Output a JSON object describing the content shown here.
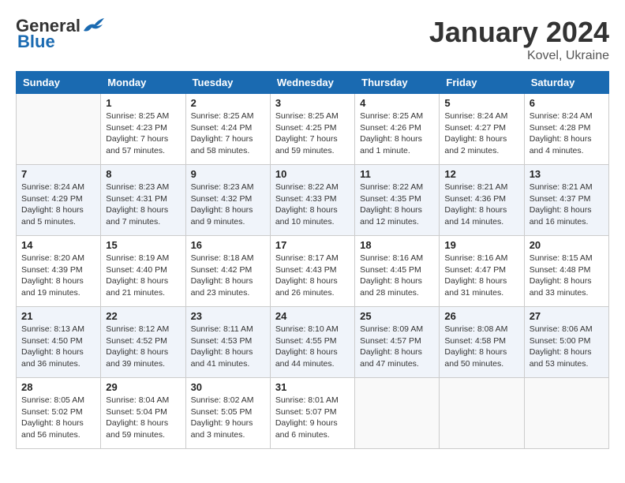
{
  "logo": {
    "general": "General",
    "blue": "Blue"
  },
  "title": "January 2024",
  "location": "Kovel, Ukraine",
  "days_header": [
    "Sunday",
    "Monday",
    "Tuesday",
    "Wednesday",
    "Thursday",
    "Friday",
    "Saturday"
  ],
  "weeks": [
    [
      {
        "day": "",
        "info": ""
      },
      {
        "day": "1",
        "info": "Sunrise: 8:25 AM\nSunset: 4:23 PM\nDaylight: 7 hours\nand 57 minutes."
      },
      {
        "day": "2",
        "info": "Sunrise: 8:25 AM\nSunset: 4:24 PM\nDaylight: 7 hours\nand 58 minutes."
      },
      {
        "day": "3",
        "info": "Sunrise: 8:25 AM\nSunset: 4:25 PM\nDaylight: 7 hours\nand 59 minutes."
      },
      {
        "day": "4",
        "info": "Sunrise: 8:25 AM\nSunset: 4:26 PM\nDaylight: 8 hours\nand 1 minute."
      },
      {
        "day": "5",
        "info": "Sunrise: 8:24 AM\nSunset: 4:27 PM\nDaylight: 8 hours\nand 2 minutes."
      },
      {
        "day": "6",
        "info": "Sunrise: 8:24 AM\nSunset: 4:28 PM\nDaylight: 8 hours\nand 4 minutes."
      }
    ],
    [
      {
        "day": "7",
        "info": "Sunrise: 8:24 AM\nSunset: 4:29 PM\nDaylight: 8 hours\nand 5 minutes."
      },
      {
        "day": "8",
        "info": "Sunrise: 8:23 AM\nSunset: 4:31 PM\nDaylight: 8 hours\nand 7 minutes."
      },
      {
        "day": "9",
        "info": "Sunrise: 8:23 AM\nSunset: 4:32 PM\nDaylight: 8 hours\nand 9 minutes."
      },
      {
        "day": "10",
        "info": "Sunrise: 8:22 AM\nSunset: 4:33 PM\nDaylight: 8 hours\nand 10 minutes."
      },
      {
        "day": "11",
        "info": "Sunrise: 8:22 AM\nSunset: 4:35 PM\nDaylight: 8 hours\nand 12 minutes."
      },
      {
        "day": "12",
        "info": "Sunrise: 8:21 AM\nSunset: 4:36 PM\nDaylight: 8 hours\nand 14 minutes."
      },
      {
        "day": "13",
        "info": "Sunrise: 8:21 AM\nSunset: 4:37 PM\nDaylight: 8 hours\nand 16 minutes."
      }
    ],
    [
      {
        "day": "14",
        "info": "Sunrise: 8:20 AM\nSunset: 4:39 PM\nDaylight: 8 hours\nand 19 minutes."
      },
      {
        "day": "15",
        "info": "Sunrise: 8:19 AM\nSunset: 4:40 PM\nDaylight: 8 hours\nand 21 minutes."
      },
      {
        "day": "16",
        "info": "Sunrise: 8:18 AM\nSunset: 4:42 PM\nDaylight: 8 hours\nand 23 minutes."
      },
      {
        "day": "17",
        "info": "Sunrise: 8:17 AM\nSunset: 4:43 PM\nDaylight: 8 hours\nand 26 minutes."
      },
      {
        "day": "18",
        "info": "Sunrise: 8:16 AM\nSunset: 4:45 PM\nDaylight: 8 hours\nand 28 minutes."
      },
      {
        "day": "19",
        "info": "Sunrise: 8:16 AM\nSunset: 4:47 PM\nDaylight: 8 hours\nand 31 minutes."
      },
      {
        "day": "20",
        "info": "Sunrise: 8:15 AM\nSunset: 4:48 PM\nDaylight: 8 hours\nand 33 minutes."
      }
    ],
    [
      {
        "day": "21",
        "info": "Sunrise: 8:13 AM\nSunset: 4:50 PM\nDaylight: 8 hours\nand 36 minutes."
      },
      {
        "day": "22",
        "info": "Sunrise: 8:12 AM\nSunset: 4:52 PM\nDaylight: 8 hours\nand 39 minutes."
      },
      {
        "day": "23",
        "info": "Sunrise: 8:11 AM\nSunset: 4:53 PM\nDaylight: 8 hours\nand 41 minutes."
      },
      {
        "day": "24",
        "info": "Sunrise: 8:10 AM\nSunset: 4:55 PM\nDaylight: 8 hours\nand 44 minutes."
      },
      {
        "day": "25",
        "info": "Sunrise: 8:09 AM\nSunset: 4:57 PM\nDaylight: 8 hours\nand 47 minutes."
      },
      {
        "day": "26",
        "info": "Sunrise: 8:08 AM\nSunset: 4:58 PM\nDaylight: 8 hours\nand 50 minutes."
      },
      {
        "day": "27",
        "info": "Sunrise: 8:06 AM\nSunset: 5:00 PM\nDaylight: 8 hours\nand 53 minutes."
      }
    ],
    [
      {
        "day": "28",
        "info": "Sunrise: 8:05 AM\nSunset: 5:02 PM\nDaylight: 8 hours\nand 56 minutes."
      },
      {
        "day": "29",
        "info": "Sunrise: 8:04 AM\nSunset: 5:04 PM\nDaylight: 8 hours\nand 59 minutes."
      },
      {
        "day": "30",
        "info": "Sunrise: 8:02 AM\nSunset: 5:05 PM\nDaylight: 9 hours\nand 3 minutes."
      },
      {
        "day": "31",
        "info": "Sunrise: 8:01 AM\nSunset: 5:07 PM\nDaylight: 9 hours\nand 6 minutes."
      },
      {
        "day": "",
        "info": ""
      },
      {
        "day": "",
        "info": ""
      },
      {
        "day": "",
        "info": ""
      }
    ]
  ]
}
